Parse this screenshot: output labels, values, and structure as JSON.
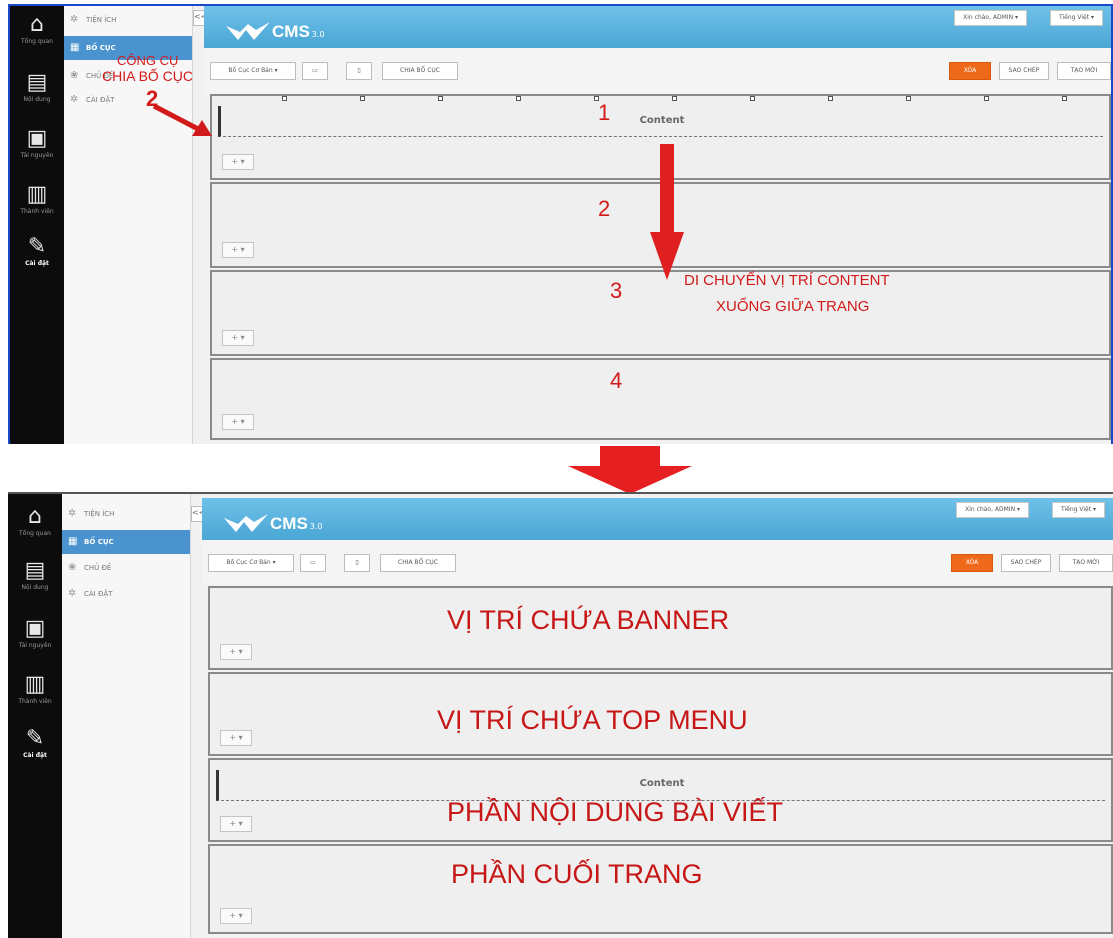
{
  "rail": {
    "items": [
      {
        "label": "Tổng quan",
        "icon": "home-icon"
      },
      {
        "label": "Nội dung",
        "icon": "document-icon"
      },
      {
        "label": "Tài nguyên",
        "icon": "archive-icon"
      },
      {
        "label": "Thành viên",
        "icon": "id-card-icon"
      },
      {
        "label": "Cài đặt",
        "icon": "wrench-icon"
      }
    ]
  },
  "sidebar": {
    "items": [
      {
        "label": "TIỆN ÍCH"
      },
      {
        "label": "BỐ CỤC"
      },
      {
        "label": "CHỦ ĐỀ"
      },
      {
        "label": "CÀI ĐẶT"
      }
    ],
    "collapse": "<<"
  },
  "header": {
    "logo_text": "CMS",
    "logo_version": "3.0",
    "greeting": "Xin chào, ADMIN ▾",
    "language": "Tiếng Việt ▾"
  },
  "toolbar": {
    "layout_select": "Bố Cục Cơ Bản ▾",
    "split_label": "CHIA BỐ CỤC",
    "delete_label": "XÓA",
    "copy_label": "SAO CHÉP",
    "new_label": "TẠO MỚI"
  },
  "content_label": "Content",
  "annotations": {
    "tool_line1": "CÔNG CỤ",
    "tool_line2": "CHIA BỐ CỤC",
    "tool_step": "2",
    "row_numbers": [
      "1",
      "2",
      "3",
      "4"
    ],
    "move_line1": "DI CHUYỂN VỊ TRÍ CONTENT",
    "move_line2": "XUỐNG GIỮA TRANG",
    "banner": "VỊ TRÍ CHỨA BANNER",
    "top_menu": "VỊ TRÍ CHỨA TOP MENU",
    "post_content": "PHẦN NỘI DUNG BÀI VIẾT",
    "footer": "PHẦN CUỐI TRANG"
  },
  "colors": {
    "accent": "#4aa6d5",
    "danger": "#ee6a1a",
    "annotation": "#d21a1a"
  }
}
